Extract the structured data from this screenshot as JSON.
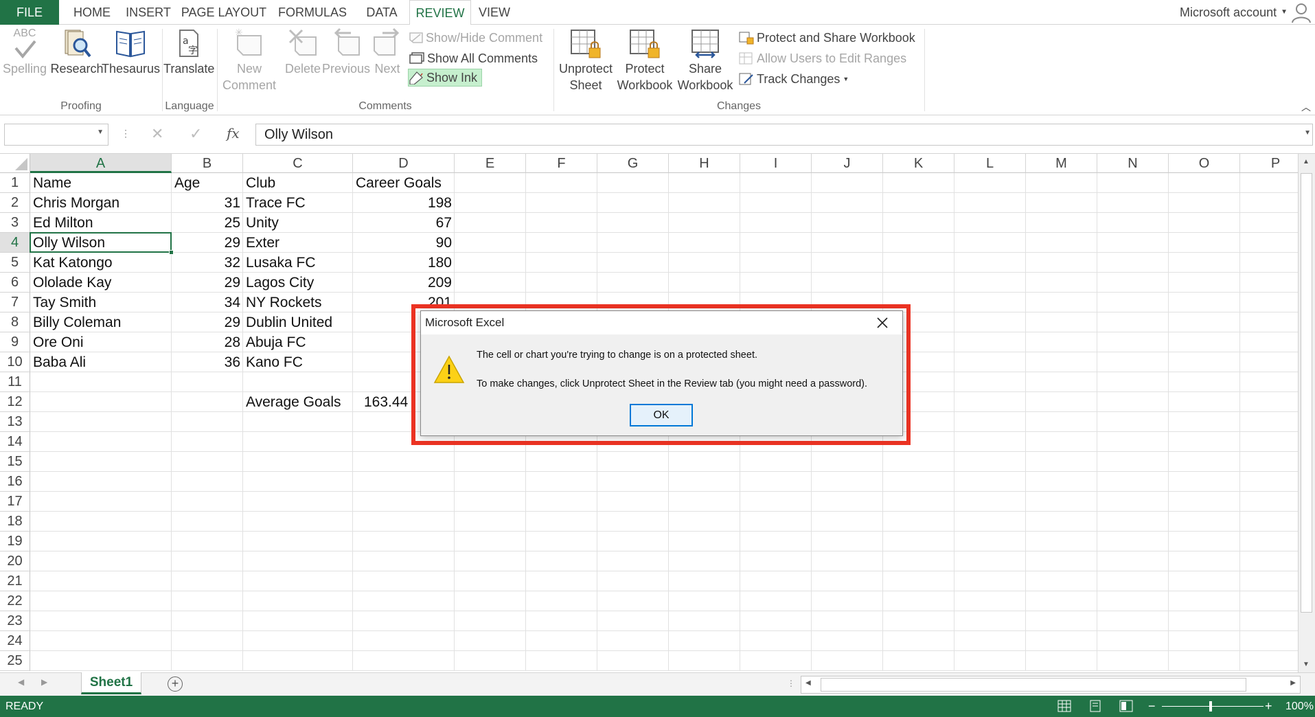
{
  "ribbon_tabs": {
    "file": "FILE",
    "home": "HOME",
    "insert": "INSERT",
    "page_layout": "PAGE LAYOUT",
    "formulas": "FORMULAS",
    "data": "DATA",
    "review": "REVIEW",
    "view": "VIEW",
    "active": "REVIEW"
  },
  "account": "Microsoft account",
  "ribbon": {
    "proofing": {
      "group_label": "Proofing",
      "spelling": "Spelling",
      "spelling_icon_text": "ABC",
      "research": "Research",
      "thesaurus": "Thesaurus"
    },
    "language": {
      "group_label": "Language",
      "translate": "Translate"
    },
    "comments": {
      "group_label": "Comments",
      "new_comment_line1": "New",
      "new_comment_line2": "Comment",
      "delete": "Delete",
      "previous": "Previous",
      "next": "Next",
      "show_hide_comment": "Show/Hide Comment",
      "show_all_comments": "Show All Comments",
      "show_ink": "Show Ink"
    },
    "changes": {
      "group_label": "Changes",
      "unprotect_sheet_line1": "Unprotect",
      "unprotect_sheet_line2": "Sheet",
      "protect_workbook_line1": "Protect",
      "protect_workbook_line2": "Workbook",
      "share_workbook_line1": "Share",
      "share_workbook_line2": "Workbook",
      "protect_and_share": "Protect and Share Workbook",
      "allow_users": "Allow Users to Edit Ranges",
      "track_changes": "Track Changes"
    }
  },
  "formula_bar": {
    "name_box": "",
    "fx": "fx",
    "value": "Olly Wilson"
  },
  "columns": [
    "A",
    "B",
    "C",
    "D",
    "E",
    "F",
    "G",
    "H",
    "I",
    "J",
    "K",
    "L",
    "M",
    "N",
    "O",
    "P"
  ],
  "selected_column": "A",
  "selected_row": "4",
  "rows": [
    "1",
    "2",
    "3",
    "4",
    "5",
    "6",
    "7",
    "8",
    "9",
    "10",
    "11",
    "12",
    "13",
    "14",
    "15",
    "16",
    "17",
    "18",
    "19",
    "20",
    "21",
    "22",
    "23",
    "24",
    "25"
  ],
  "cells": {
    "header": {
      "name": "Name",
      "age": "Age",
      "club": "Club",
      "goals": "Career Goals"
    },
    "players": [
      {
        "name": "Chris Morgan",
        "age": "31",
        "club": "Trace FC",
        "goals": "198"
      },
      {
        "name": "Ed Milton",
        "age": "25",
        "club": "Unity",
        "goals": "67"
      },
      {
        "name": "Olly Wilson",
        "age": "29",
        "club": "Exter",
        "goals": "90"
      },
      {
        "name": "Kat Katongo",
        "age": "32",
        "club": "Lusaka FC",
        "goals": "180"
      },
      {
        "name": "Ololade Kay",
        "age": "29",
        "club": "Lagos City",
        "goals": "209"
      },
      {
        "name": "Tay Smith",
        "age": "34",
        "club": "NY Rockets",
        "goals": "201"
      },
      {
        "name": "Billy Coleman",
        "age": "29",
        "club": "Dublin United",
        "goals": ""
      },
      {
        "name": "Ore Oni",
        "age": "28",
        "club": "Abuja FC",
        "goals": ""
      },
      {
        "name": "Baba Ali",
        "age": "36",
        "club": "Kano FC",
        "goals": ""
      }
    ],
    "average_label": "Average Goals",
    "average_value": "163.44"
  },
  "sheet_tabs": [
    "Sheet1"
  ],
  "status": {
    "mode": "READY",
    "zoom": "100%"
  },
  "dialog": {
    "title": "Microsoft Excel",
    "message_line1": "The cell or chart you're trying to change is on a protected sheet.",
    "message_line2": "To make changes, click Unprotect Sheet in the Review tab (you might need a password).",
    "ok_label": "OK"
  },
  "colors": {
    "excel_green": "#217346",
    "highlight_red": "#ec3323",
    "ok_blue": "#0078d7"
  }
}
